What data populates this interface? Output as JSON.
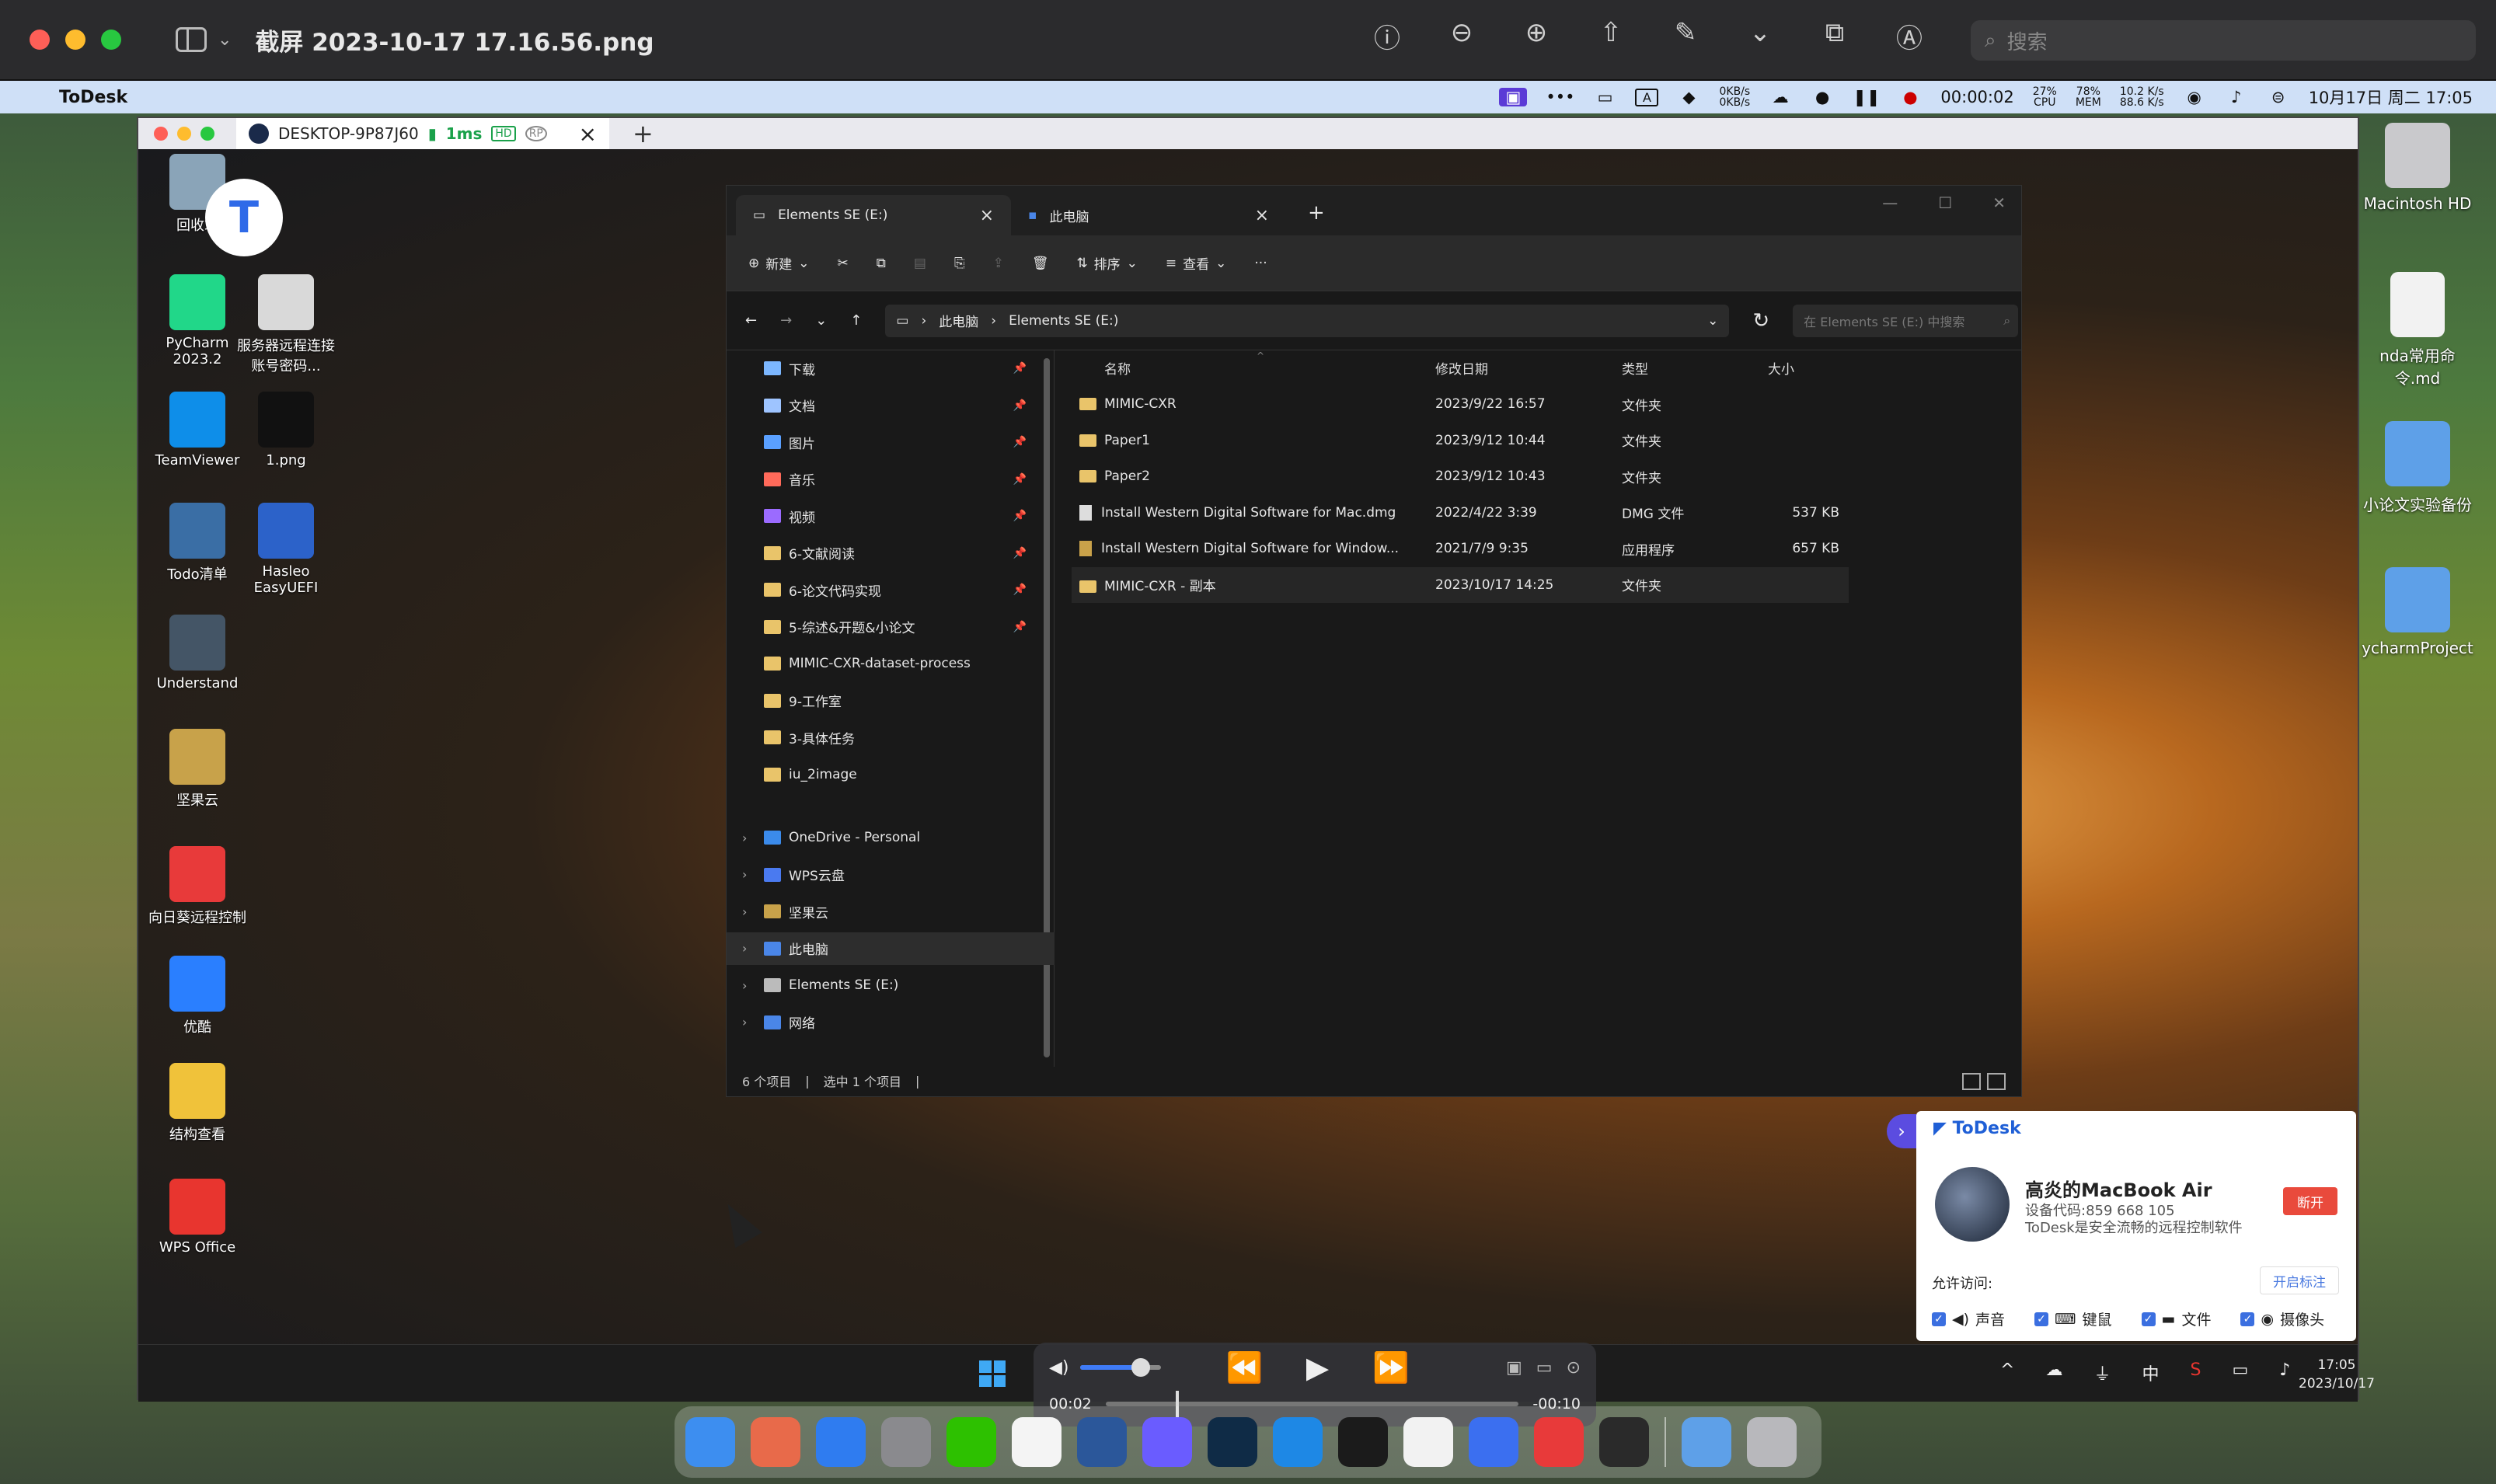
{
  "preview": {
    "title": "截屏 2023-10-17 17.16.56.png",
    "search_placeholder": "搜索",
    "tools": [
      "ⓘ",
      "⊖",
      "⊕",
      "⇧",
      "✎",
      "⌄",
      "⧉",
      "Ⓐ",
      "▭"
    ]
  },
  "mac_menubar": {
    "app_name": "ToDesk",
    "net_up": "0KB/s",
    "net_down": "0KB/s",
    "timer": "00:00:02",
    "cpu": "27%",
    "cpu_label": "CPU",
    "mem": "78%",
    "mem_label": "MEM",
    "speed_up": "10.2 K/s",
    "speed_down": "88.6 K/s",
    "input_method": "A",
    "clock": "10月17日 周二 17:05"
  },
  "mac_desktop_icons": [
    {
      "label": "Macintosh HD",
      "color": "#c9c9cc"
    },
    {
      "label": "nda常用命令.md",
      "color": "#f2f2f2"
    },
    {
      "label": "小论文实验备份",
      "color": "#5ea0e8"
    },
    {
      "label": "ycharmProject",
      "color": "#5ea0e8"
    }
  ],
  "remote_window": {
    "tab_title": "DESKTOP-9P87J60",
    "latency": "1ms",
    "badge_hd": "HD",
    "badge_rp": "RP"
  },
  "win_desktop_icons": [
    {
      "label": "回收站",
      "color": "#8aa4b8"
    },
    {
      "label": "PyCharm 2023.2",
      "color": "#21d789"
    },
    {
      "label": "服务器远程连接账号密码...",
      "color": "#d9d9d9"
    },
    {
      "label": "TeamViewer",
      "color": "#0e8ee9"
    },
    {
      "label": "1.png",
      "color": "#111111"
    },
    {
      "label": "Todo清单",
      "color": "#3a6ea5"
    },
    {
      "label": "Hasleo EasyUEFI",
      "color": "#2c62c9"
    },
    {
      "label": "Understand",
      "color": "#445566"
    },
    {
      "label": "坚果云",
      "color": "#c8a24a"
    },
    {
      "label": "向日葵远程控制",
      "color": "#e83a3a"
    },
    {
      "label": "优酷",
      "color": "#2a7fff"
    },
    {
      "label": "结构查看",
      "color": "#f0c23a"
    },
    {
      "label": "WPS Office",
      "color": "#e8352f"
    }
  ],
  "explorer": {
    "tabs": [
      {
        "title": "Elements SE (E:)",
        "active": true
      },
      {
        "title": "此电脑",
        "active": false
      }
    ],
    "toolbar": {
      "new": "新建",
      "sort": "排序",
      "view": "查看",
      "more": "···"
    },
    "breadcrumb": [
      "此电脑",
      "Elements SE (E:)"
    ],
    "search_placeholder": "在 Elements SE (E:) 中搜索",
    "nav_quick": [
      {
        "label": "下载",
        "pinned": true,
        "color": "#7cb7ff"
      },
      {
        "label": "文档",
        "pinned": true,
        "color": "#9ec4ff"
      },
      {
        "label": "图片",
        "pinned": true,
        "color": "#5aa0ff"
      },
      {
        "label": "音乐",
        "pinned": true,
        "color": "#ff6a5a"
      },
      {
        "label": "视频",
        "pinned": true,
        "color": "#9b6bff"
      },
      {
        "label": "6-文献阅读",
        "pinned": true,
        "color": "#e9c46a"
      },
      {
        "label": "6-论文代码实现",
        "pinned": true,
        "color": "#e9c46a"
      },
      {
        "label": "5-综述&开题&小论文",
        "pinned": true,
        "color": "#e9c46a"
      },
      {
        "label": "MIMIC-CXR-dataset-process",
        "pinned": false,
        "color": "#e9c46a"
      },
      {
        "label": "9-工作室",
        "pinned": false,
        "color": "#e9c46a"
      },
      {
        "label": "3-具体任务",
        "pinned": false,
        "color": "#e9c46a"
      },
      {
        "label": "iu_2image",
        "pinned": false,
        "color": "#e9c46a"
      }
    ],
    "nav_tree": [
      {
        "label": "OneDrive - Personal",
        "color": "#3b8beb"
      },
      {
        "label": "WPS云盘",
        "color": "#4a7af0"
      },
      {
        "label": "坚果云",
        "color": "#c8a24a"
      },
      {
        "label": "此电脑",
        "color": "#4a86e8",
        "selected": true
      },
      {
        "label": "Elements SE (E:)",
        "color": "#bbbbbb"
      },
      {
        "label": "网络",
        "color": "#4a86e8"
      }
    ],
    "columns": {
      "name": "名称",
      "modified": "修改日期",
      "type": "类型",
      "size": "大小"
    },
    "files": [
      {
        "name": "MIMIC-CXR",
        "modified": "2023/9/22 16:57",
        "type": "文件夹",
        "size": "",
        "kind": "folder"
      },
      {
        "name": "Paper1",
        "modified": "2023/9/12 10:44",
        "type": "文件夹",
        "size": "",
        "kind": "folder"
      },
      {
        "name": "Paper2",
        "modified": "2023/9/12 10:43",
        "type": "文件夹",
        "size": "",
        "kind": "folder"
      },
      {
        "name": "Install Western Digital Software for Mac.dmg",
        "modified": "2022/4/22 3:39",
        "type": "DMG 文件",
        "size": "537 KB",
        "kind": "file"
      },
      {
        "name": "Install Western Digital Software for Window...",
        "modified": "2021/7/9 9:35",
        "type": "应用程序",
        "size": "657 KB",
        "kind": "app"
      },
      {
        "name": "MIMIC-CXR - 副本",
        "modified": "2023/10/17 14:25",
        "type": "文件夹",
        "size": "",
        "kind": "folder",
        "selected": true
      }
    ],
    "status_count": "6 个项目",
    "status_selected": "选中 1 个项目"
  },
  "win_taskbar": {
    "tray_ime": "中",
    "time": "17:05",
    "date": "2023/10/17"
  },
  "video": {
    "elapsed": "00:02",
    "remaining": "-00:10",
    "progress": 0.17,
    "volume": 0.75
  },
  "todesk_panel": {
    "brand": "ToDesk",
    "device_name": "高炎的MacBook Air",
    "device_code": "设备代码:859 668 105",
    "description": "ToDesk是安全流畅的远程控制软件",
    "disconnect": "断开",
    "allow_label": "允许访问:",
    "annotate": "开启标注",
    "permissions": [
      "声音",
      "键鼠",
      "文件",
      "摄像头"
    ]
  },
  "dock_apps": [
    {
      "name": "finder",
      "color": "#3d8ef0"
    },
    {
      "name": "launchpad",
      "color": "#e86a4a"
    },
    {
      "name": "safari",
      "color": "#2f7cf0"
    },
    {
      "name": "settings",
      "color": "#8a8a8e"
    },
    {
      "name": "wechat",
      "color": "#2dc100"
    },
    {
      "name": "qq",
      "color": "#f4f4f4"
    },
    {
      "name": "word",
      "color": "#2b579a"
    },
    {
      "name": "mindnode",
      "color": "#6a5cff"
    },
    {
      "name": "deepl",
      "color": "#0f2b46"
    },
    {
      "name": "edge",
      "color": "#1e88e5"
    },
    {
      "name": "terminal",
      "color": "#1b1b1b"
    },
    {
      "name": "typora",
      "color": "#f2f2f2"
    },
    {
      "name": "todesk",
      "color": "#3b6ff0"
    },
    {
      "name": "sunlogin",
      "color": "#e83a3a"
    },
    {
      "name": "screen-recorder",
      "color": "#2a2a2a"
    },
    {
      "name": "downloads",
      "color": "#5ea0e8"
    },
    {
      "name": "trash",
      "color": "#b8b8bc"
    }
  ]
}
